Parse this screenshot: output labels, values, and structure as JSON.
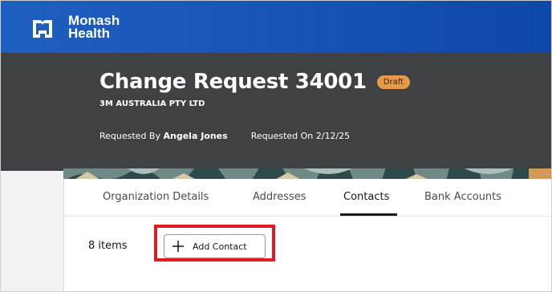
{
  "brand": {
    "name_line1": "Monash",
    "name_line2": "Health",
    "logo_icon": "monash-health-logo-icon"
  },
  "header": {
    "title": "Change Request 34001",
    "status_badge": "Draft",
    "organization": "3M AUSTRALIA PTY LTD",
    "requested_by_label": "Requested By",
    "requested_by_value": "Angela Jones",
    "requested_on_label": "Requested On",
    "requested_on_value": "2/12/25"
  },
  "tabs": [
    {
      "label": "Organization Details",
      "active": false
    },
    {
      "label": "Addresses",
      "active": false
    },
    {
      "label": "Contacts",
      "active": true
    },
    {
      "label": "Bank Accounts",
      "active": false
    }
  ],
  "contacts": {
    "item_count": "8 items",
    "add_button_label": "Add Contact",
    "add_icon": "plus-icon"
  },
  "colors": {
    "brand_blue": "#1552b4",
    "header_dark": "#3f4245",
    "badge_orange": "#e79947",
    "highlight_red": "#e21b23"
  }
}
